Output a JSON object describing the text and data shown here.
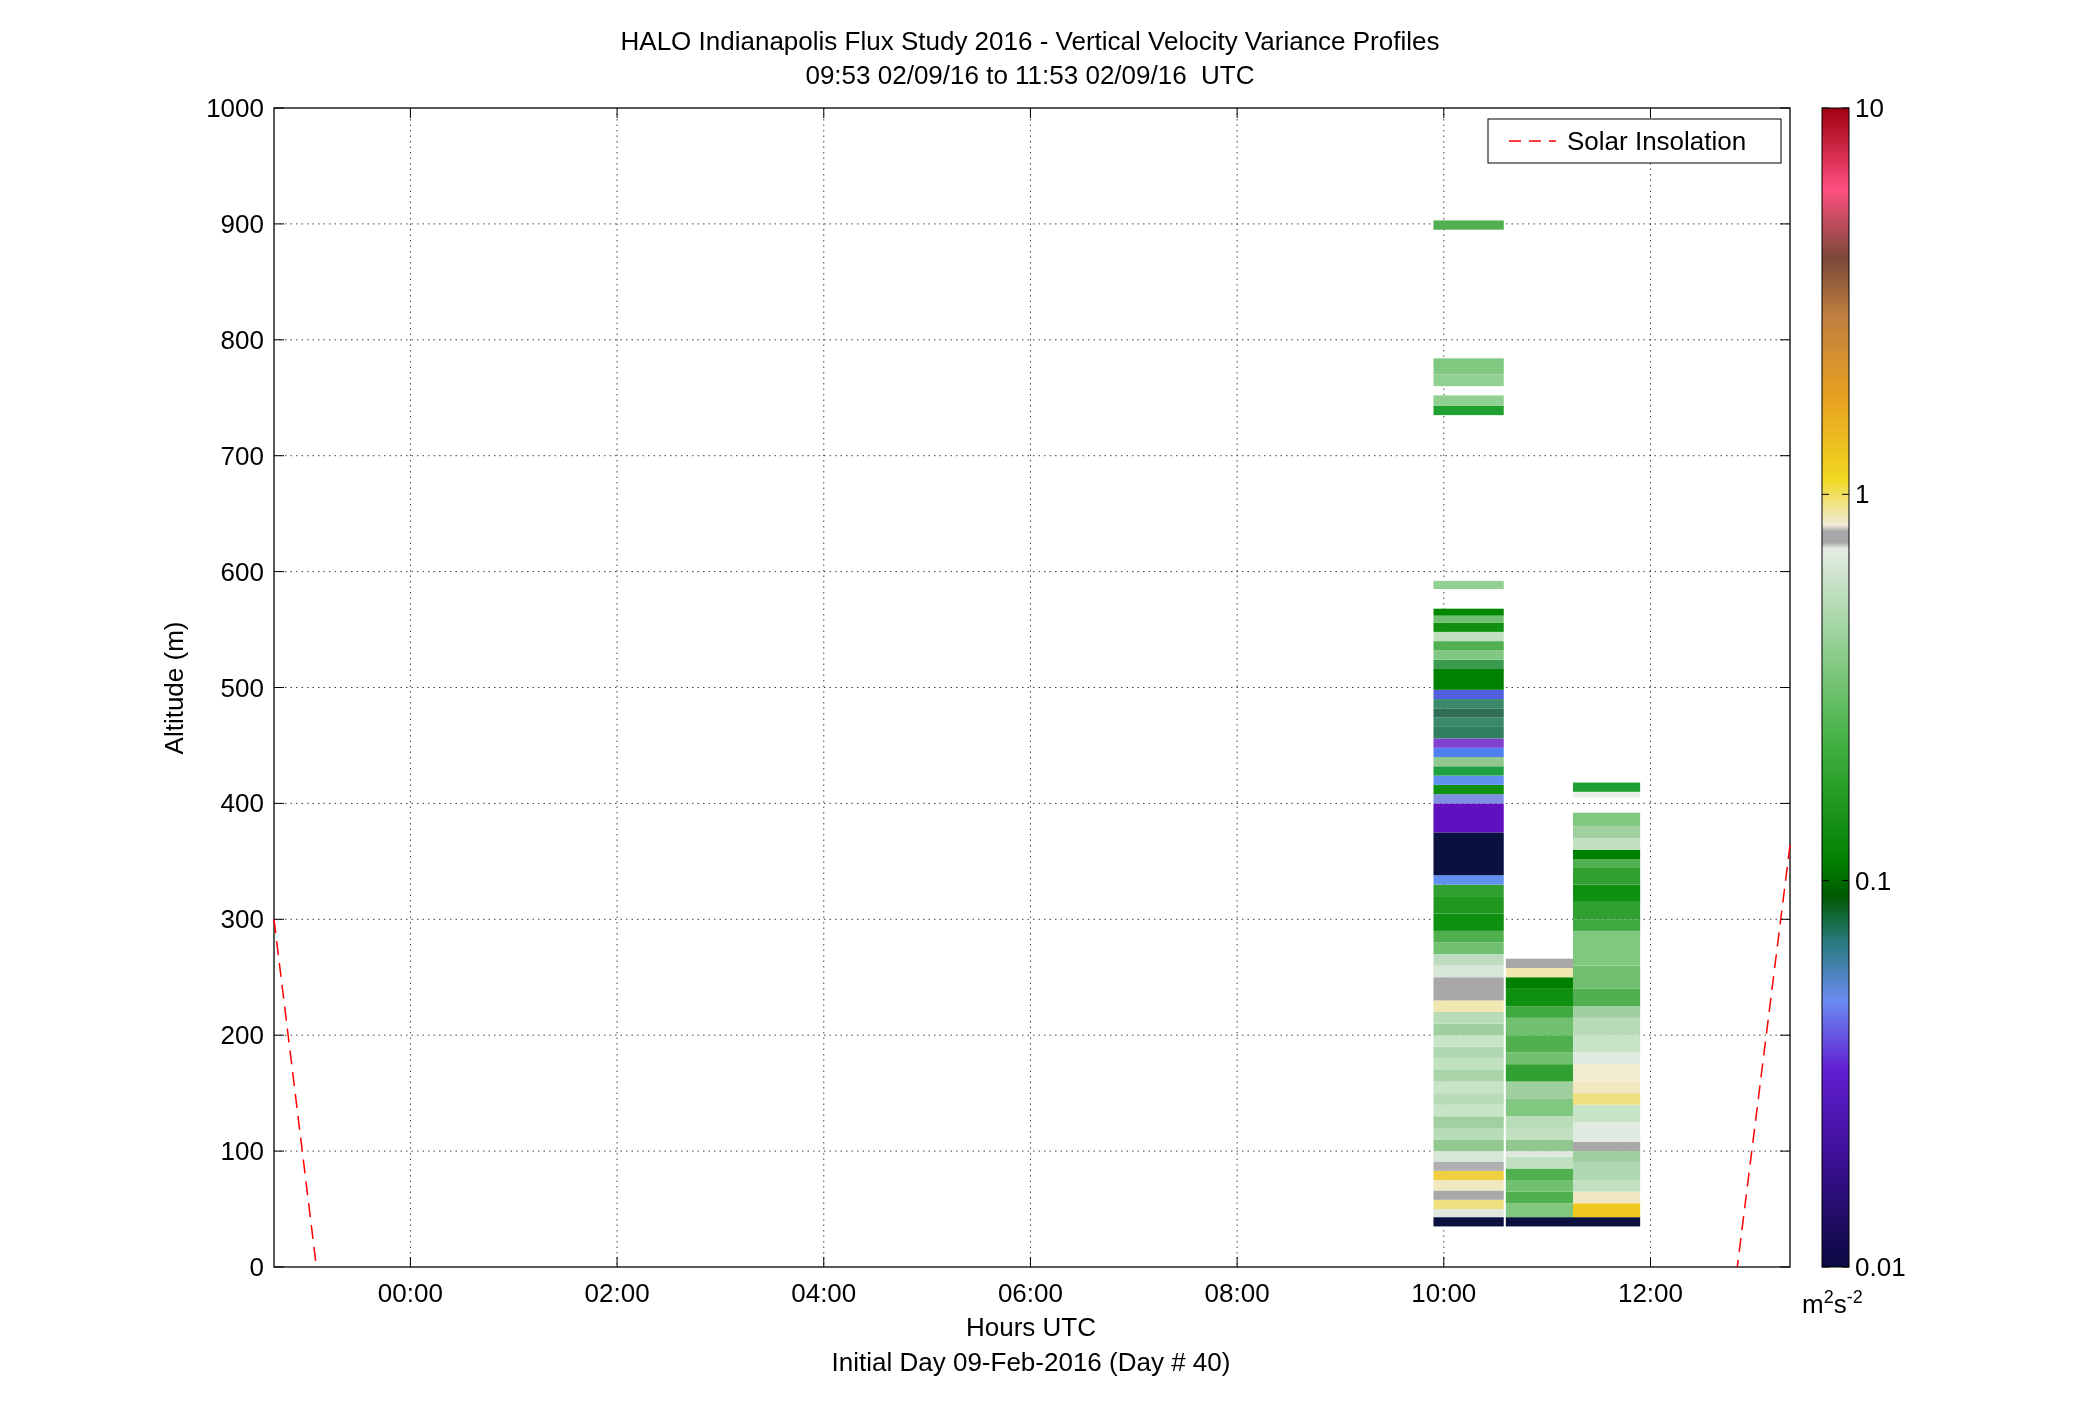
{
  "figure": {
    "title": "HALO Indianapolis Flux Study 2016 - Vertical Velocity Variance Profiles",
    "subtitle": "09:53 02/09/16 to 11:53 02/09/16  UTC",
    "note": "Initial Day 09-Feb-2016 (Day # 40)",
    "chart_data": {
      "type": "line",
      "xlabel": "Hours UTC",
      "ylabel": "Altitude (m)",
      "x": [
        -1.32,
        -0.91,
        6,
        12.84,
        13.35
      ],
      "grid": true,
      "series": [
        {
          "name": "Solar Insolation",
          "color": "#ff0000",
          "line_style": "dashed",
          "values": [
            300,
            0,
            null,
            0,
            364
          ]
        }
      ],
      "xlim": [
        -1.32,
        13.35
      ],
      "ylim": [
        0,
        1000
      ],
      "xticks": [
        {
          "value": 0,
          "label": "00:00"
        },
        {
          "value": 2,
          "label": "02:00"
        },
        {
          "value": 4,
          "label": "04:00"
        },
        {
          "value": 6,
          "label": "06:00"
        },
        {
          "value": 8,
          "label": "08:00"
        },
        {
          "value": 10,
          "label": "10:00"
        },
        {
          "value": 12,
          "label": "12:00"
        }
      ],
      "yticks": [
        0,
        100,
        200,
        300,
        400,
        500,
        600,
        700,
        800,
        900,
        1000
      ]
    },
    "colorbar": {
      "ticks": [
        "10",
        "1",
        "0.1",
        "0.01"
      ],
      "unit": "m$^{2}$s$^{-2}$"
    }
  }
}
